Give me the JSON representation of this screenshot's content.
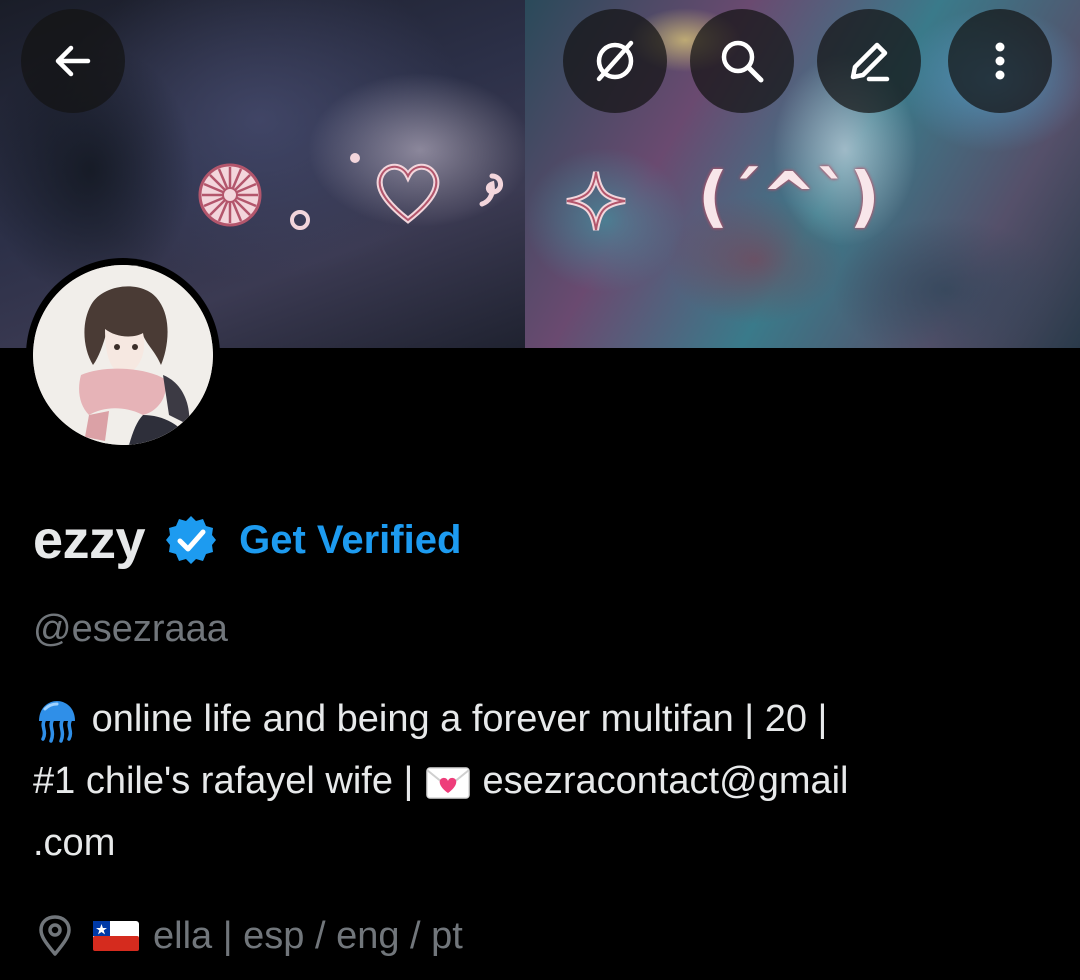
{
  "header": {
    "back_icon": "arrow-left-icon",
    "actions": [
      "unmute-slash-icon",
      "search-icon",
      "edit-pencil-icon",
      "more-vertical-icon"
    ],
    "banner_kaomoji": "(ˊ^ˋ)"
  },
  "profile": {
    "display_name": "ezzy",
    "verified_badge_color": "#1d9bf0",
    "get_verified_label": "Get Verified",
    "handle": "@esezraaa",
    "bio": {
      "line1": "online life and being a forever multifan | 20 |",
      "line2_a": "#1 chile's rafayel wife |",
      "line2_b": "esezracontact@gmail",
      "line3": ".com"
    },
    "location": "ella | esp / eng / pt"
  },
  "colors": {
    "background": "#000000",
    "text": "#e7e9ea",
    "muted": "#71767b",
    "accent": "#1d9bf0"
  }
}
